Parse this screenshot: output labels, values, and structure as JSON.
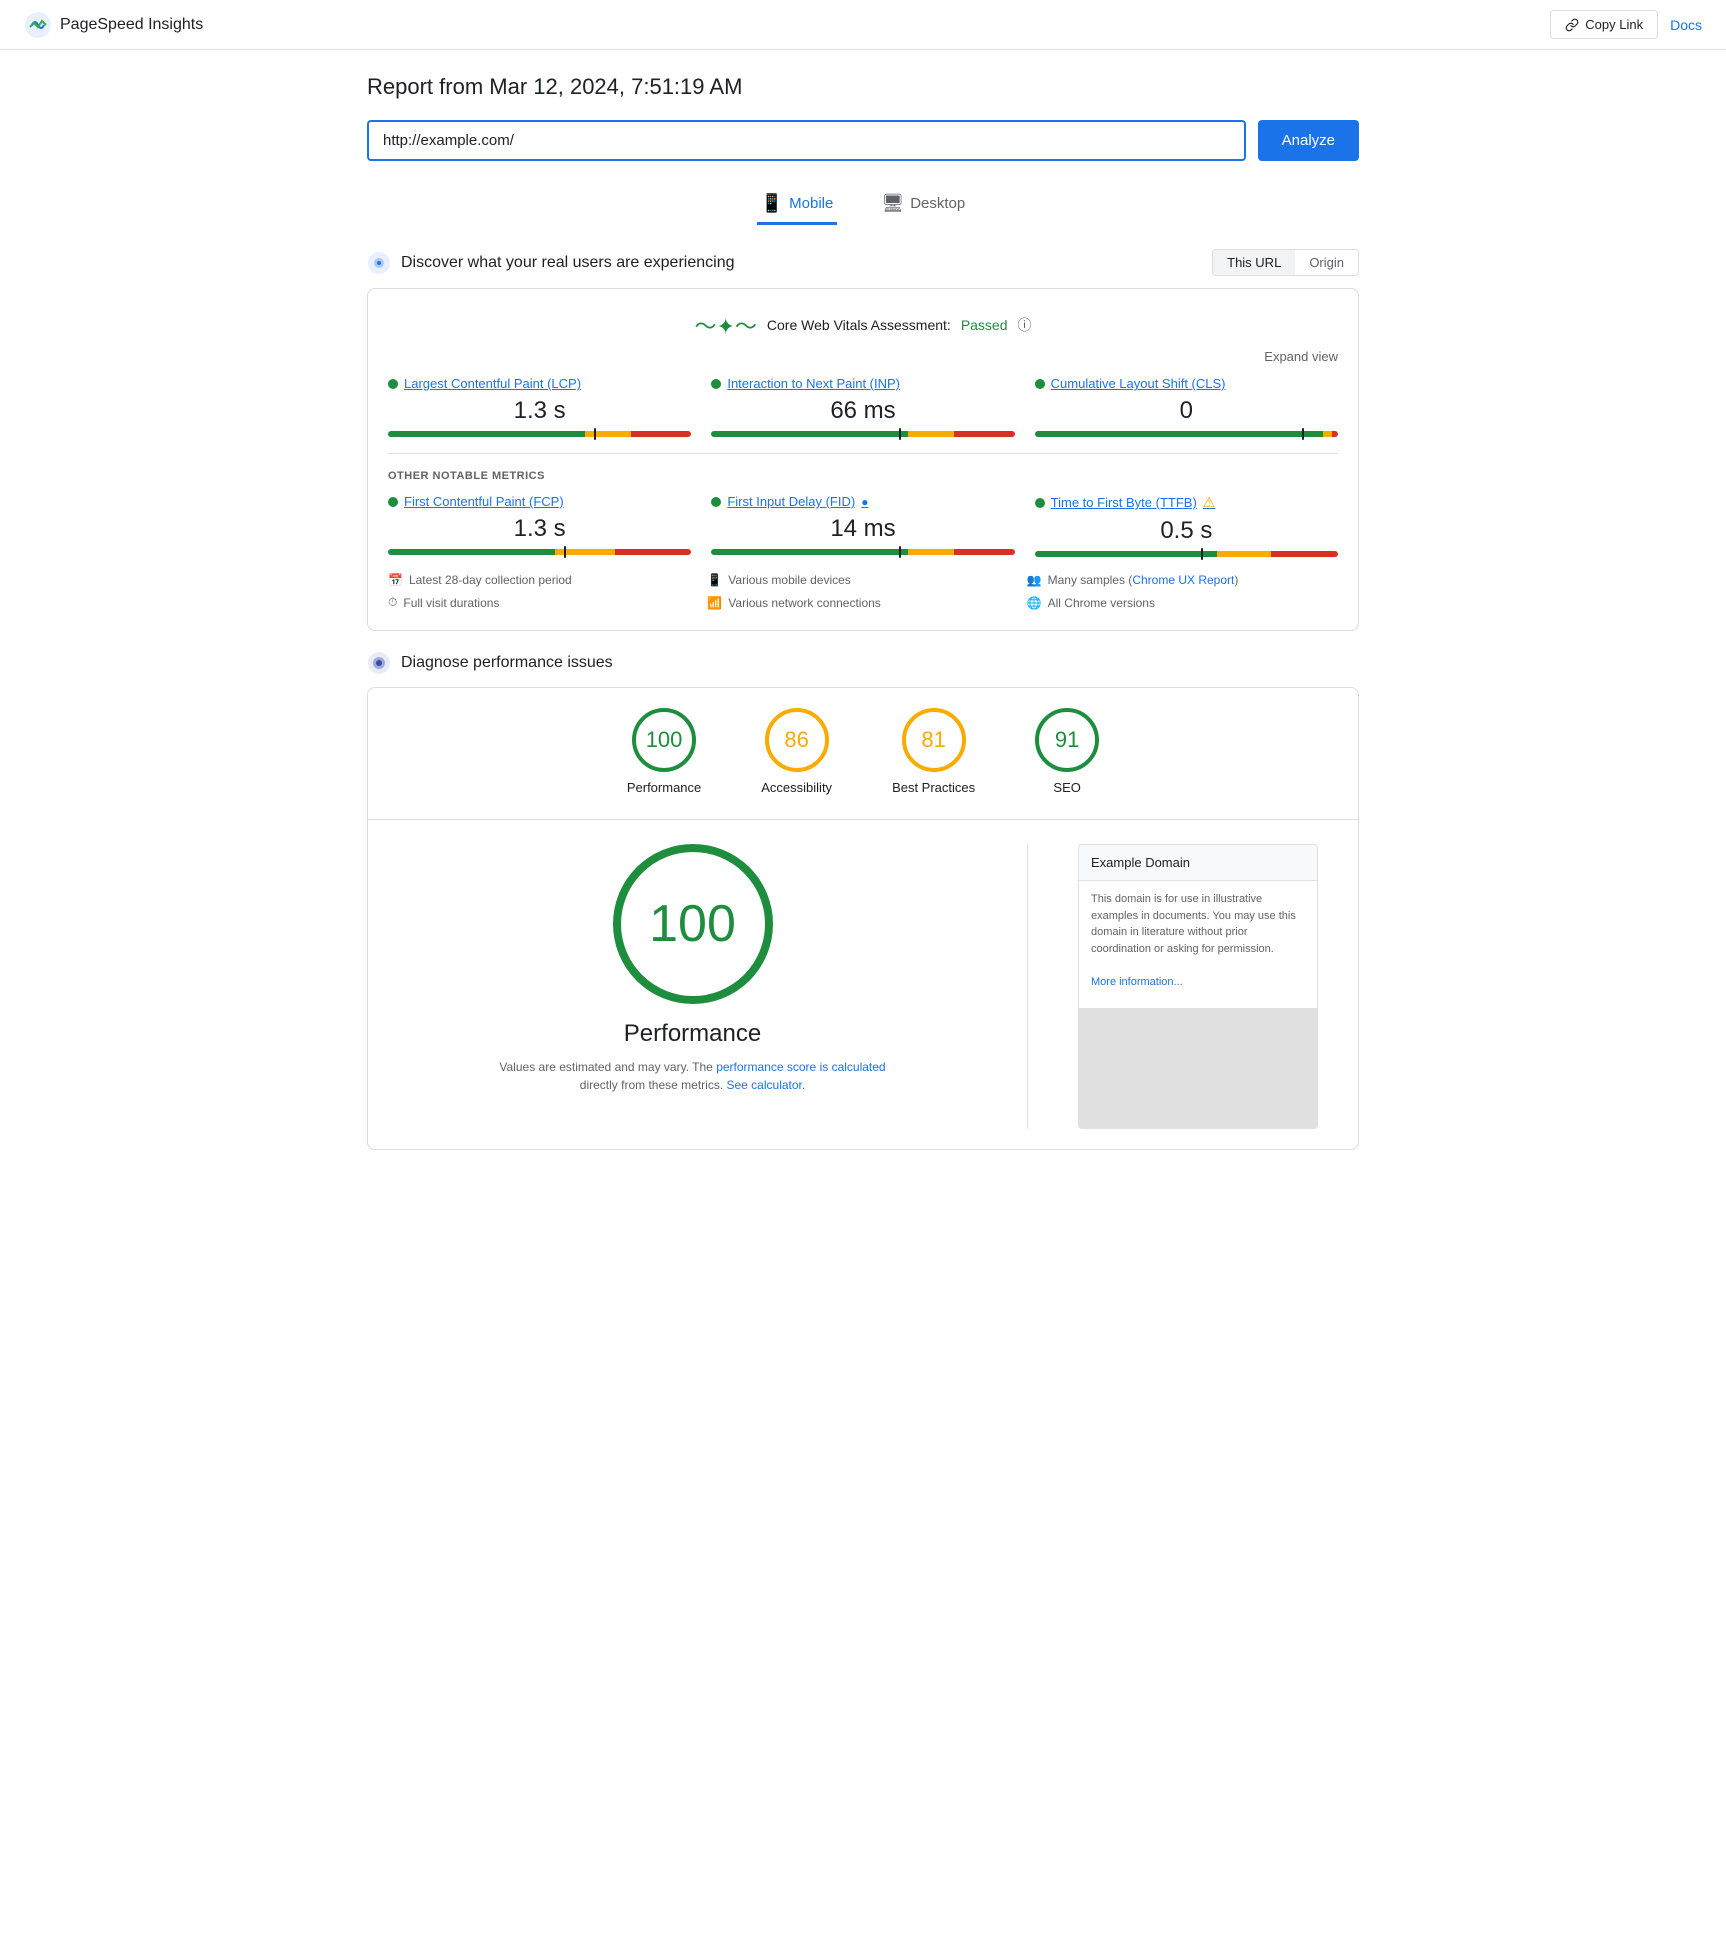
{
  "header": {
    "app_name": "PageSpeed Insights",
    "copy_link_label": "Copy Link",
    "docs_label": "Docs"
  },
  "report": {
    "title": "Report from Mar 12, 2024, 7:51:19 AM",
    "url_value": "http://example.com/",
    "analyze_label": "Analyze"
  },
  "tabs": [
    {
      "id": "mobile",
      "label": "Mobile",
      "active": true
    },
    {
      "id": "desktop",
      "label": "Desktop",
      "active": false
    }
  ],
  "crux": {
    "section_title": "Discover what your real users are experiencing",
    "toggle": {
      "this_url": "This URL",
      "origin": "Origin"
    },
    "cwv": {
      "assessment_label": "Core Web Vitals Assessment:",
      "status": "Passed",
      "expand_label": "Expand view"
    },
    "metrics": [
      {
        "name": "Largest Contentful Paint (LCP)",
        "value": "1.3 s",
        "green_pct": 65,
        "orange_pct": 15,
        "red_pct": 20,
        "marker_pct": 68
      },
      {
        "name": "Interaction to Next Paint (INP)",
        "value": "66 ms",
        "green_pct": 65,
        "orange_pct": 15,
        "red_pct": 20,
        "marker_pct": 62
      },
      {
        "name": "Cumulative Layout Shift (CLS)",
        "value": "0",
        "green_pct": 95,
        "orange_pct": 3,
        "red_pct": 2,
        "marker_pct": 88
      }
    ],
    "notable_label": "OTHER NOTABLE METRICS",
    "notable_metrics": [
      {
        "name": "First Contentful Paint (FCP)",
        "value": "1.3 s",
        "green_pct": 55,
        "orange_pct": 20,
        "red_pct": 25,
        "marker_pct": 58
      },
      {
        "name": "First Input Delay (FID)",
        "value": "14 ms",
        "green_pct": 65,
        "orange_pct": 15,
        "red_pct": 20,
        "marker_pct": 62,
        "has_info": true
      },
      {
        "name": "Time to First Byte (TTFB)",
        "value": "0.5 s",
        "green_pct": 60,
        "orange_pct": 18,
        "red_pct": 22,
        "marker_pct": 55,
        "has_warning": true
      }
    ],
    "info_items": [
      {
        "icon": "📅",
        "text": "Latest 28-day collection period"
      },
      {
        "icon": "📱",
        "text": "Various mobile devices"
      },
      {
        "icon": "👥",
        "text": "Many samples (Chrome UX Report)"
      },
      {
        "icon": "⏱",
        "text": "Full visit durations"
      },
      {
        "icon": "📶",
        "text": "Various network connections"
      },
      {
        "icon": "🌐",
        "text": "All Chrome versions"
      }
    ]
  },
  "diagnose": {
    "section_title": "Diagnose performance issues",
    "scores": [
      {
        "id": "performance",
        "value": "100",
        "label": "Performance",
        "color_class": "score-green"
      },
      {
        "id": "accessibility",
        "value": "86",
        "label": "Accessibility",
        "color_class": "score-orange"
      },
      {
        "id": "best-practices",
        "value": "81",
        "label": "Best Practices",
        "color_class": "score-orange"
      },
      {
        "id": "seo",
        "value": "91",
        "label": "SEO",
        "color_class": "score-green"
      }
    ],
    "performance_detail": {
      "big_score": "100",
      "title": "Performance",
      "desc_before": "Values are estimated and may vary. The",
      "link1_text": "performance score is calculated",
      "desc_middle": "directly from these metrics.",
      "link2_text": "See calculator.",
      "screenshot": {
        "title": "Example Domain",
        "body": "This domain is for use in illustrative examples in documents. You may use this domain in literature without prior coordination or asking for permission.",
        "link": "More information..."
      }
    }
  }
}
